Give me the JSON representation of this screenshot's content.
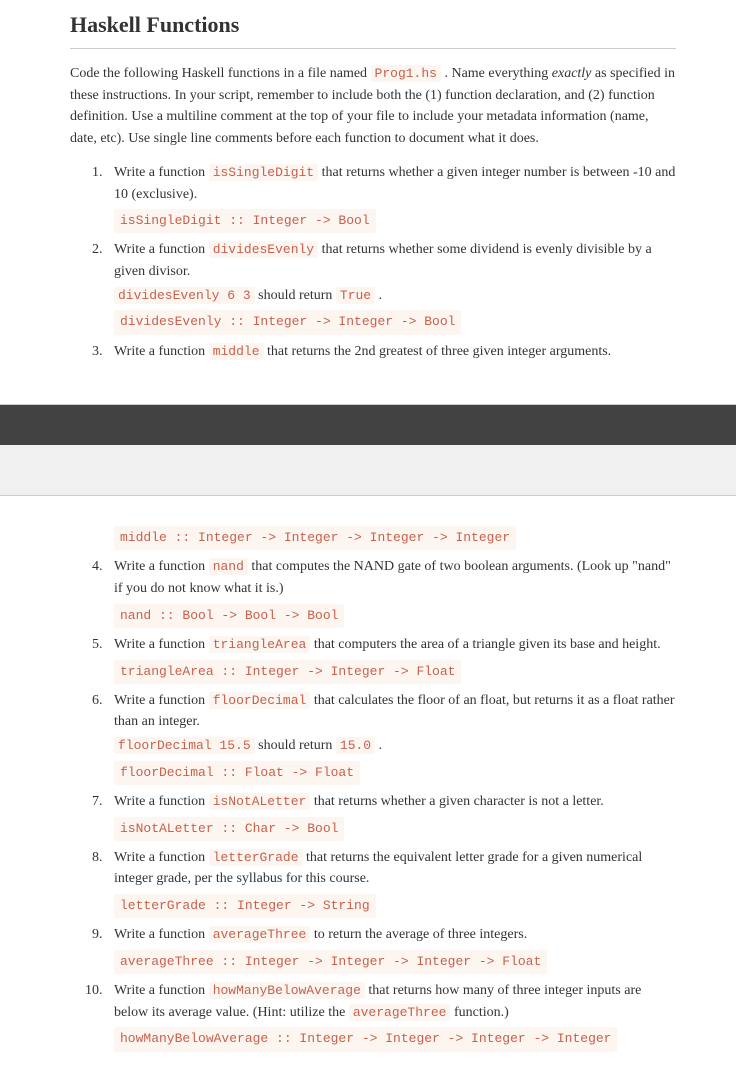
{
  "title": "Haskell Functions",
  "intro_parts": {
    "p1": "Code the following Haskell functions in a file named ",
    "file": "Prog1.hs",
    "p2": " . Name everything ",
    "exactly": "exactly",
    "p3": " as specified in these instructions. In your script, remember to include both the (1) function declaration, and (2) function definition. Use a multiline comment at the top of your file to include your metadata information (name, date, etc). Use single line comments before each function to document what it does."
  },
  "items": [
    {
      "pre": " Write a function ",
      "fn": "isSingleDigit",
      "post": " that returns whether a given integer number is between -10 and 10 (exclusive).",
      "sig": "isSingleDigit :: Integer -> Bool"
    },
    {
      "pre": " Write a function ",
      "fn": "dividesEvenly",
      "post": " that returns whether some dividend is evenly divisible by a given divisor.",
      "ex_call": "dividesEvenly 6 3",
      "ex_mid": " should return ",
      "ex_val": "True",
      "ex_end": " .",
      "sig": "dividesEvenly :: Integer -> Integer -> Bool"
    },
    {
      "pre": " Write a function ",
      "fn": "middle",
      "post": " that returns the 2nd greatest of three given integer arguments.",
      "sig": "middle :: Integer -> Integer -> Integer -> Integer"
    },
    {
      "pre": " Write a function ",
      "fn": "nand",
      "post": " that computes the NAND gate of two boolean arguments. (Look up \"nand\" if you do not know what it is.)",
      "sig": "nand :: Bool -> Bool -> Bool"
    },
    {
      "pre": " Write a function ",
      "fn": "triangleArea",
      "post": " that computers the area of a triangle given its base and height.",
      "sig": "triangleArea :: Integer -> Integer -> Float"
    },
    {
      "pre": " Write a function ",
      "fn": "floorDecimal",
      "post": " that calculates the floor of an float, but returns it as a float rather than an integer.",
      "ex_call": "floorDecimal 15.5",
      "ex_mid": " should return ",
      "ex_val": "15.0",
      "ex_end": " .",
      "sig": "floorDecimal :: Float -> Float"
    },
    {
      "pre": " Write a function ",
      "fn": "isNotALetter",
      "post": " that returns whether a given character is not a letter.",
      "sig": "isNotALetter :: Char -> Bool"
    },
    {
      "pre": " Write a function ",
      "fn": "letterGrade",
      "post": " that returns the equivalent letter grade for a given numerical integer grade, per the syllabus for this course.",
      "sig": "letterGrade :: Integer -> String"
    },
    {
      "pre": " Write a function ",
      "fn": "averageThree",
      "post": " to return the average of three integers.",
      "sig": "averageThree :: Integer -> Integer -> Integer -> Float"
    },
    {
      "pre": " Write a function ",
      "fn": "howManyBelowAverage",
      "post": " that returns how many of three integer inputs are below its average value. (Hint: utilize the ",
      "hint_fn": "averageThree",
      "post2": " function.)",
      "sig": "howManyBelowAverage :: Integer -> Integer -> Integer -> Integer"
    }
  ]
}
